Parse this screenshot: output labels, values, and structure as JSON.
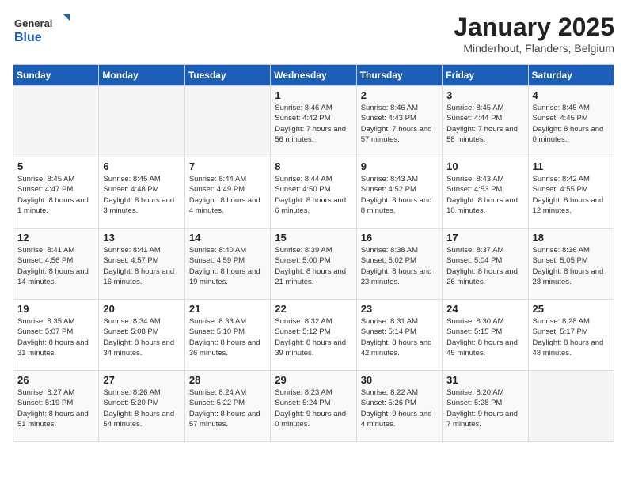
{
  "header": {
    "logo_general": "General",
    "logo_blue": "Blue",
    "title": "January 2025",
    "location": "Minderhout, Flanders, Belgium"
  },
  "days_of_week": [
    "Sunday",
    "Monday",
    "Tuesday",
    "Wednesday",
    "Thursday",
    "Friday",
    "Saturday"
  ],
  "weeks": [
    [
      {
        "day": "",
        "info": ""
      },
      {
        "day": "",
        "info": ""
      },
      {
        "day": "",
        "info": ""
      },
      {
        "day": "1",
        "info": "Sunrise: 8:46 AM\nSunset: 4:42 PM\nDaylight: 7 hours\nand 56 minutes."
      },
      {
        "day": "2",
        "info": "Sunrise: 8:46 AM\nSunset: 4:43 PM\nDaylight: 7 hours\nand 57 minutes."
      },
      {
        "day": "3",
        "info": "Sunrise: 8:45 AM\nSunset: 4:44 PM\nDaylight: 7 hours\nand 58 minutes."
      },
      {
        "day": "4",
        "info": "Sunrise: 8:45 AM\nSunset: 4:45 PM\nDaylight: 8 hours\nand 0 minutes."
      }
    ],
    [
      {
        "day": "5",
        "info": "Sunrise: 8:45 AM\nSunset: 4:47 PM\nDaylight: 8 hours\nand 1 minute."
      },
      {
        "day": "6",
        "info": "Sunrise: 8:45 AM\nSunset: 4:48 PM\nDaylight: 8 hours\nand 3 minutes."
      },
      {
        "day": "7",
        "info": "Sunrise: 8:44 AM\nSunset: 4:49 PM\nDaylight: 8 hours\nand 4 minutes."
      },
      {
        "day": "8",
        "info": "Sunrise: 8:44 AM\nSunset: 4:50 PM\nDaylight: 8 hours\nand 6 minutes."
      },
      {
        "day": "9",
        "info": "Sunrise: 8:43 AM\nSunset: 4:52 PM\nDaylight: 8 hours\nand 8 minutes."
      },
      {
        "day": "10",
        "info": "Sunrise: 8:43 AM\nSunset: 4:53 PM\nDaylight: 8 hours\nand 10 minutes."
      },
      {
        "day": "11",
        "info": "Sunrise: 8:42 AM\nSunset: 4:55 PM\nDaylight: 8 hours\nand 12 minutes."
      }
    ],
    [
      {
        "day": "12",
        "info": "Sunrise: 8:41 AM\nSunset: 4:56 PM\nDaylight: 8 hours\nand 14 minutes."
      },
      {
        "day": "13",
        "info": "Sunrise: 8:41 AM\nSunset: 4:57 PM\nDaylight: 8 hours\nand 16 minutes."
      },
      {
        "day": "14",
        "info": "Sunrise: 8:40 AM\nSunset: 4:59 PM\nDaylight: 8 hours\nand 19 minutes."
      },
      {
        "day": "15",
        "info": "Sunrise: 8:39 AM\nSunset: 5:00 PM\nDaylight: 8 hours\nand 21 minutes."
      },
      {
        "day": "16",
        "info": "Sunrise: 8:38 AM\nSunset: 5:02 PM\nDaylight: 8 hours\nand 23 minutes."
      },
      {
        "day": "17",
        "info": "Sunrise: 8:37 AM\nSunset: 5:04 PM\nDaylight: 8 hours\nand 26 minutes."
      },
      {
        "day": "18",
        "info": "Sunrise: 8:36 AM\nSunset: 5:05 PM\nDaylight: 8 hours\nand 28 minutes."
      }
    ],
    [
      {
        "day": "19",
        "info": "Sunrise: 8:35 AM\nSunset: 5:07 PM\nDaylight: 8 hours\nand 31 minutes."
      },
      {
        "day": "20",
        "info": "Sunrise: 8:34 AM\nSunset: 5:08 PM\nDaylight: 8 hours\nand 34 minutes."
      },
      {
        "day": "21",
        "info": "Sunrise: 8:33 AM\nSunset: 5:10 PM\nDaylight: 8 hours\nand 36 minutes."
      },
      {
        "day": "22",
        "info": "Sunrise: 8:32 AM\nSunset: 5:12 PM\nDaylight: 8 hours\nand 39 minutes."
      },
      {
        "day": "23",
        "info": "Sunrise: 8:31 AM\nSunset: 5:14 PM\nDaylight: 8 hours\nand 42 minutes."
      },
      {
        "day": "24",
        "info": "Sunrise: 8:30 AM\nSunset: 5:15 PM\nDaylight: 8 hours\nand 45 minutes."
      },
      {
        "day": "25",
        "info": "Sunrise: 8:28 AM\nSunset: 5:17 PM\nDaylight: 8 hours\nand 48 minutes."
      }
    ],
    [
      {
        "day": "26",
        "info": "Sunrise: 8:27 AM\nSunset: 5:19 PM\nDaylight: 8 hours\nand 51 minutes."
      },
      {
        "day": "27",
        "info": "Sunrise: 8:26 AM\nSunset: 5:20 PM\nDaylight: 8 hours\nand 54 minutes."
      },
      {
        "day": "28",
        "info": "Sunrise: 8:24 AM\nSunset: 5:22 PM\nDaylight: 8 hours\nand 57 minutes."
      },
      {
        "day": "29",
        "info": "Sunrise: 8:23 AM\nSunset: 5:24 PM\nDaylight: 9 hours\nand 0 minutes."
      },
      {
        "day": "30",
        "info": "Sunrise: 8:22 AM\nSunset: 5:26 PM\nDaylight: 9 hours\nand 4 minutes."
      },
      {
        "day": "31",
        "info": "Sunrise: 8:20 AM\nSunset: 5:28 PM\nDaylight: 9 hours\nand 7 minutes."
      },
      {
        "day": "",
        "info": ""
      }
    ]
  ]
}
